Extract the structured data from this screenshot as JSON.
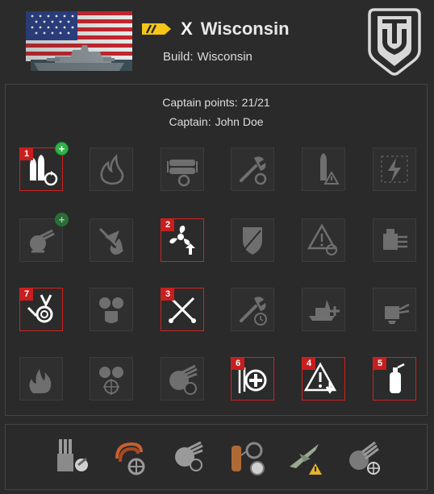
{
  "header": {
    "tier": "X",
    "ship_name": "Wisconsin",
    "build_label": "Build:",
    "build_value": "Wisconsin"
  },
  "captain": {
    "points_label": "Captain points:",
    "points_value": "21/21",
    "name_label": "Captain:",
    "name_value": "John Doe"
  },
  "skills": [
    {
      "row": 1,
      "col": 1,
      "icon": "ammo-reload-icon",
      "selected": true,
      "order": "1",
      "plus": true
    },
    {
      "row": 1,
      "col": 2,
      "icon": "fire-icon",
      "selected": false
    },
    {
      "row": 1,
      "col": 3,
      "icon": "torpedo-reload-icon",
      "selected": false
    },
    {
      "row": 1,
      "col": 4,
      "icon": "wrench-reload-icon",
      "selected": false
    },
    {
      "row": 1,
      "col": 5,
      "icon": "shell-warning-icon",
      "selected": false
    },
    {
      "row": 1,
      "col": 6,
      "icon": "lightning-icon",
      "selected": false
    },
    {
      "row": 2,
      "col": 1,
      "icon": "secondary-gun-icon",
      "selected": false,
      "plus": true
    },
    {
      "row": 2,
      "col": 2,
      "icon": "plane-fire-icon",
      "selected": false
    },
    {
      "row": 2,
      "col": 3,
      "icon": "fan-boost-icon",
      "selected": true,
      "order": "2"
    },
    {
      "row": 2,
      "col": 4,
      "icon": "shield-icon",
      "selected": false
    },
    {
      "row": 2,
      "col": 5,
      "icon": "alert-crosshair-icon",
      "selected": false
    },
    {
      "row": 2,
      "col": 6,
      "icon": "turret-icon",
      "selected": false
    },
    {
      "row": 3,
      "col": 1,
      "icon": "flag-spiral-icon",
      "selected": true,
      "order": "7"
    },
    {
      "row": 3,
      "col": 2,
      "icon": "guns-shield-icon",
      "selected": false
    },
    {
      "row": 3,
      "col": 3,
      "icon": "crossed-tools-icon",
      "selected": true,
      "order": "3"
    },
    {
      "row": 3,
      "col": 4,
      "icon": "wrench-clock-icon",
      "selected": false
    },
    {
      "row": 3,
      "col": 5,
      "icon": "battleship-plus-icon",
      "selected": false
    },
    {
      "row": 3,
      "col": 6,
      "icon": "gun-turret-icon",
      "selected": false
    },
    {
      "row": 4,
      "col": 1,
      "icon": "flames-icon",
      "selected": false
    },
    {
      "row": 4,
      "col": 2,
      "icon": "guns-crosshair-icon",
      "selected": false
    },
    {
      "row": 4,
      "col": 3,
      "icon": "turret-clock-icon",
      "selected": false
    },
    {
      "row": 4,
      "col": 4,
      "icon": "heal-icon",
      "selected": true,
      "order": "6"
    },
    {
      "row": 4,
      "col": 5,
      "icon": "alert-down-icon",
      "selected": true,
      "order": "4"
    },
    {
      "row": 4,
      "col": 6,
      "icon": "extinguisher-icon",
      "selected": true,
      "order": "5"
    }
  ],
  "modifications": [
    {
      "icon": "guns-wrench-icon"
    },
    {
      "icon": "hose-valve-icon"
    },
    {
      "icon": "turret-clock-icon"
    },
    {
      "icon": "tank-gauges-icon"
    },
    {
      "icon": "plane-alert-icon"
    },
    {
      "icon": "turret-crosshair-icon"
    }
  ],
  "colors": {
    "background": "#2b2b2b",
    "selected_border": "#d42020",
    "order_badge": "#c81e1e",
    "plus_badge": "#2fb34a",
    "tier_badge": "#f5c518"
  }
}
